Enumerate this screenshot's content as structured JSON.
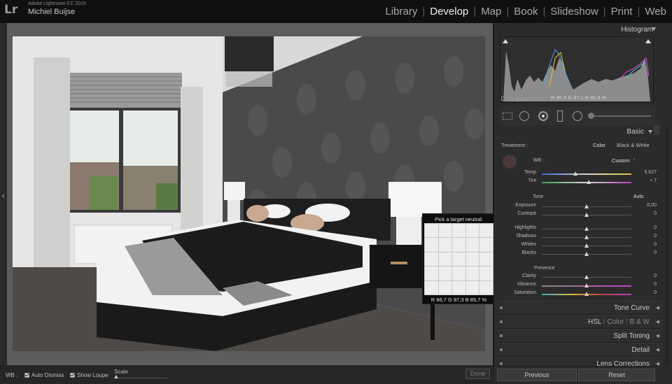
{
  "app": {
    "logo": "Lr",
    "product": "Adobe Lightroom CC 2015",
    "user": "Michiel Buijse"
  },
  "modules": [
    {
      "label": "Library",
      "active": false
    },
    {
      "label": "Develop",
      "active": true
    },
    {
      "label": "Map",
      "active": false
    },
    {
      "label": "Book",
      "active": false
    },
    {
      "label": "Slideshow",
      "active": false
    },
    {
      "label": "Print",
      "active": false
    },
    {
      "label": "Web",
      "active": false
    }
  ],
  "module_separator": "|",
  "histogram": {
    "title": "Histogram",
    "rgb": {
      "r_label": "R",
      "r": "86,6",
      "g_label": "G",
      "g": "87,1",
      "b_label": "B",
      "b": "85,6",
      "unit": "%"
    },
    "original_photo": "Original Photo"
  },
  "basic": {
    "title": "Basic",
    "treatment_label": "Treatment :",
    "color": "Color",
    "bw": "Black & White",
    "wb_label": "WB :",
    "wb_value": "Custom",
    "temp": {
      "label": "Temp",
      "value": "5.627",
      "pos": 0.38
    },
    "tint": {
      "label": "Tint",
      "value": "+ 7",
      "pos": 0.53
    },
    "tone_label": "Tone",
    "auto": "Auto",
    "tone_sliders": [
      {
        "label": "Exposure",
        "value": "0,00",
        "pos": 0.5
      },
      {
        "label": "Contrast",
        "value": "0",
        "pos": 0.5
      }
    ],
    "tone_sliders2": [
      {
        "label": "Highlights",
        "value": "0",
        "pos": 0.5
      },
      {
        "label": "Shadows",
        "value": "0",
        "pos": 0.5
      },
      {
        "label": "Whites",
        "value": "0",
        "pos": 0.5
      },
      {
        "label": "Blacks",
        "value": "0",
        "pos": 0.5
      }
    ],
    "presence_label": "Presence",
    "presence_sliders": [
      {
        "label": "Clarity",
        "value": "0",
        "pos": 0.5
      },
      {
        "label": "Vibrance",
        "value": "0",
        "pos": 0.5
      },
      {
        "label": "Saturation",
        "value": "0",
        "pos": 0.5
      }
    ]
  },
  "panels": {
    "tone_curve": "Tone Curve",
    "hsl": "HSL",
    "hsl_color": "Color",
    "hsl_bw": "B & W",
    "hsl_sep": "/",
    "split_toning": "Split Toning",
    "detail": "Detail",
    "lens": "Lens Corrections"
  },
  "buttons": {
    "previous": "Previous",
    "reset": "Reset",
    "done": "Done"
  },
  "toolbar": {
    "wb_label": "WB :",
    "auto_dismiss": "Auto Dismiss",
    "show_loupe": "Show Loupe",
    "scale": "Scale"
  },
  "loupe": {
    "title": "Pick a target neutral:",
    "r_label": "R",
    "r": "86,7",
    "g_label": "G",
    "g": "87,3",
    "b_label": "B",
    "b": "85,7",
    "unit": "%"
  },
  "colors": {
    "accent": "#f0f0f0",
    "panel_bg": "#2b2b2b",
    "topbar_bg": "#101010"
  }
}
